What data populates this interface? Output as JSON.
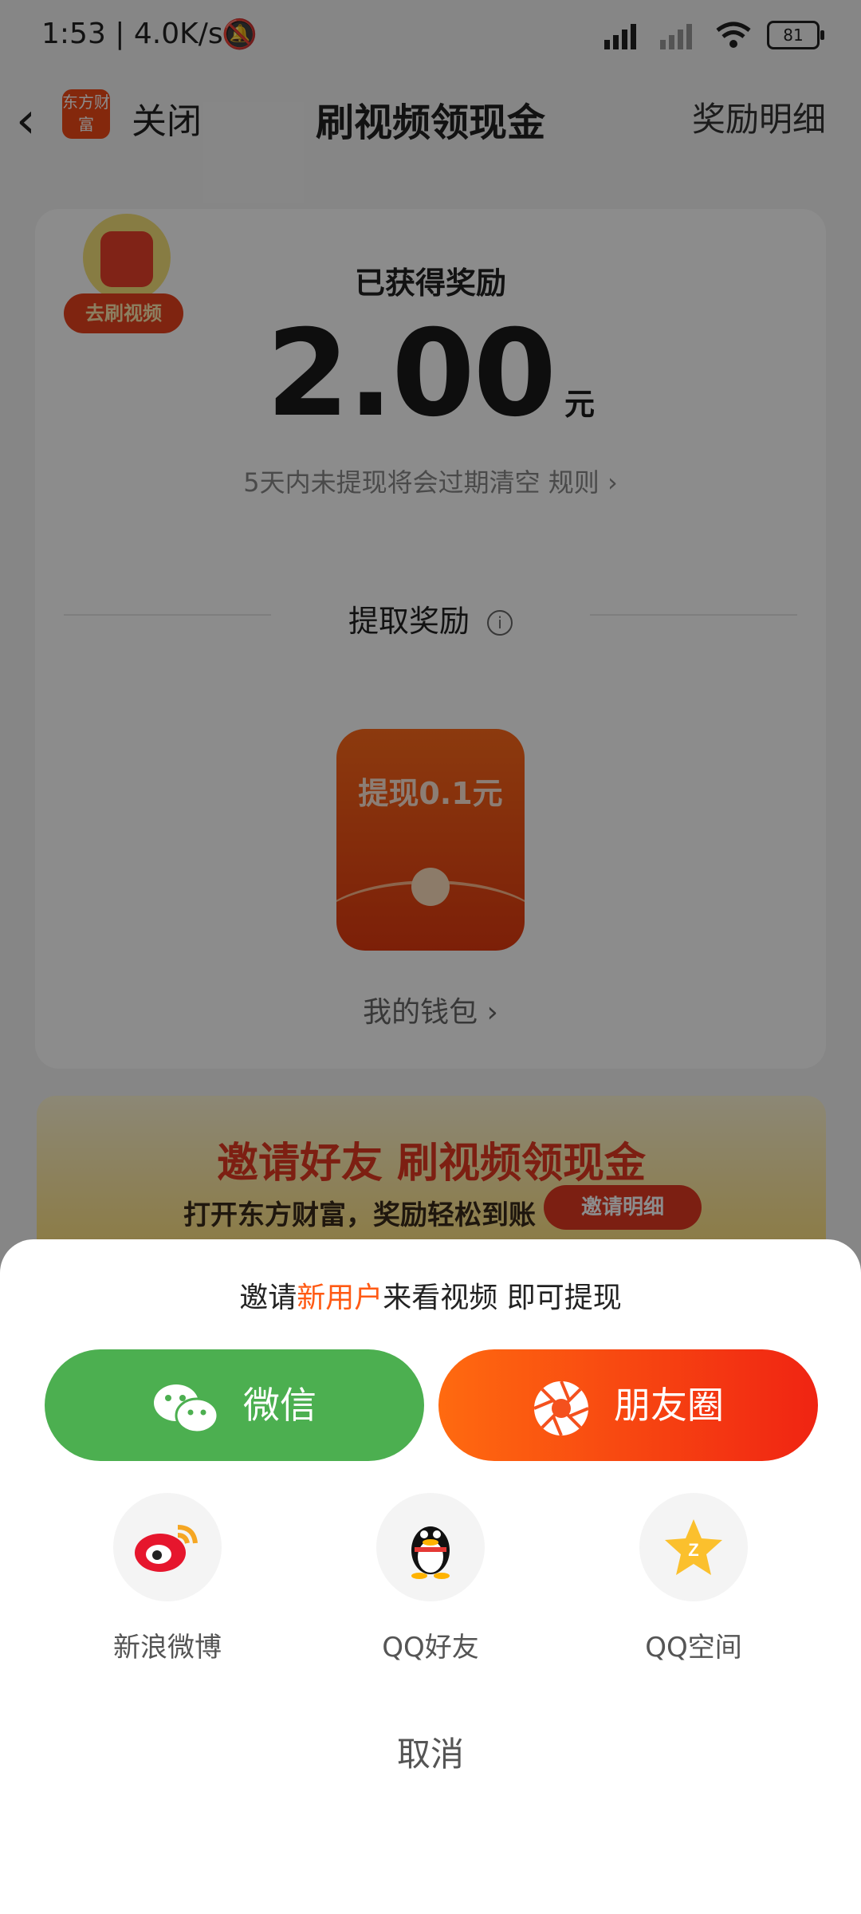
{
  "status_bar": {
    "time": "1:53 | 4.0K/s",
    "battery": "81"
  },
  "nav": {
    "back_label": "‹",
    "logo_text": "东方财富",
    "close_label": "关闭",
    "title": "刷视频领现金",
    "detail_label": "奖励明细"
  },
  "reward": {
    "badge_label": "去刷视频",
    "earned_label": "已获得奖励",
    "amount": "2.00",
    "unit": "元",
    "expire_note": "5天内未提现将会过期清空 规则 ›",
    "extract_label": "提取奖励",
    "withdraw_label": "提现0.1元",
    "wallet_link": "我的钱包 ›"
  },
  "banner": {
    "title": "邀请好友 刷视频领现金",
    "subtitle": "打开东方财富，奖励轻松到账",
    "button": "邀请明细"
  },
  "share_sheet": {
    "prompt_pre": "邀请",
    "prompt_highlight": "新用户",
    "prompt_post": "来看视频 即可提现",
    "wechat_label": "微信",
    "moments_label": "朋友圈",
    "items": [
      {
        "label": "新浪微博",
        "icon": "weibo-icon"
      },
      {
        "label": "QQ好友",
        "icon": "qq-icon"
      },
      {
        "label": "QQ空间",
        "icon": "qzone-icon"
      }
    ],
    "cancel_label": "取消"
  },
  "colors": {
    "accent": "#ff5a14",
    "wechat_green": "#4caf50",
    "moments_red": "#f02412"
  }
}
